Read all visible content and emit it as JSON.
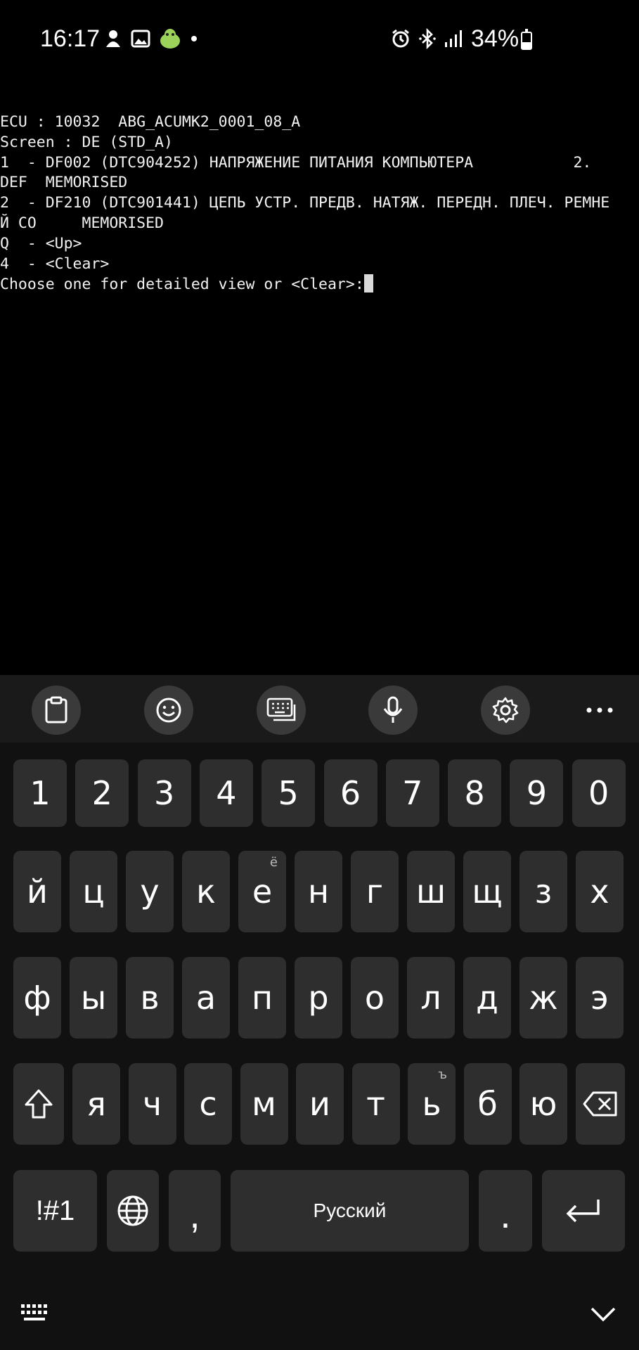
{
  "status_bar": {
    "time": "16:17",
    "battery": "34%",
    "left_icons": [
      "app-icon",
      "image-icon",
      "android-badge-icon",
      "dot-icon"
    ],
    "right_icons": [
      "alarm-icon",
      "bluetooth-icon",
      "signal-icon",
      "battery-icon"
    ]
  },
  "terminal": {
    "lines": [
      "ECU : 10032  ABG_ACUMK2_0001_08_A",
      "Screen : DE (STD_A)",
      "1  - DF002 (DTC904252) НАПРЯЖЕНИЕ ПИТАНИЯ КОМПЬЮТЕРА           2.",
      "DEF  MEMORISED",
      "2  - DF210 (DTC901441) ЦЕПЬ УСТР. ПРЕДВ. НАТЯЖ. ПЕРЕДН. ПЛЕЧ. РЕМНЕ",
      "Й СО     MEMORISED",
      "Q  - <Up>",
      "4  - <Clear>",
      "Choose one for detailed view or <Clear>:"
    ]
  },
  "keyboard": {
    "toolbar": [
      "clipboard-icon",
      "emoji-icon",
      "keyboard-mode-icon",
      "microphone-icon",
      "settings-icon",
      "more-icon"
    ],
    "row_numbers": [
      "1",
      "2",
      "3",
      "4",
      "5",
      "6",
      "7",
      "8",
      "9",
      "0"
    ],
    "row1": [
      {
        "k": "й",
        "s": ""
      },
      {
        "k": "ц",
        "s": ""
      },
      {
        "k": "у",
        "s": ""
      },
      {
        "k": "к",
        "s": ""
      },
      {
        "k": "е",
        "s": "ё"
      },
      {
        "k": "н",
        "s": ""
      },
      {
        "k": "г",
        "s": ""
      },
      {
        "k": "ш",
        "s": ""
      },
      {
        "k": "щ",
        "s": ""
      },
      {
        "k": "з",
        "s": ""
      },
      {
        "k": "х",
        "s": ""
      }
    ],
    "row2": [
      "ф",
      "ы",
      "в",
      "а",
      "п",
      "р",
      "о",
      "л",
      "д",
      "ж",
      "э"
    ],
    "row3": [
      {
        "k": "я",
        "s": ""
      },
      {
        "k": "ч",
        "s": ""
      },
      {
        "k": "с",
        "s": ""
      },
      {
        "k": "м",
        "s": ""
      },
      {
        "k": "и",
        "s": ""
      },
      {
        "k": "т",
        "s": ""
      },
      {
        "k": "ь",
        "s": "ъ"
      },
      {
        "k": "б",
        "s": ""
      },
      {
        "k": "ю",
        "s": ""
      }
    ],
    "symbols_key": "!#1",
    "comma_key": ",",
    "space_label": "Русский",
    "period_key": "."
  }
}
